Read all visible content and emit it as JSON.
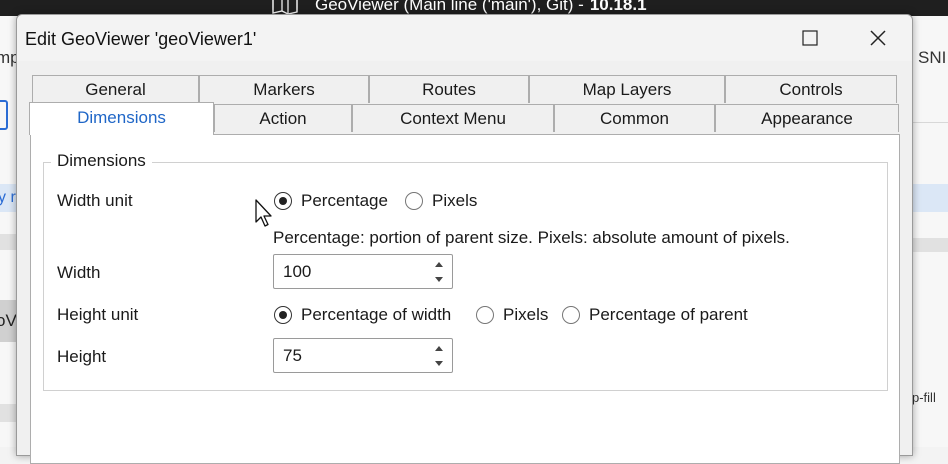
{
  "background": {
    "title": "GeoViewer (Main line ('main'), Git)  -",
    "version": "10.18.1",
    "fragments": {
      "left_top": "mp",
      "left_link": "y r",
      "left_overlay": "oV",
      "right_top": "SNI",
      "right_fill": "p-fill"
    }
  },
  "dialog": {
    "title": "Edit GeoViewer 'geoViewer1'",
    "tabs_row1": [
      "General",
      "Markers",
      "Routes",
      "Map Layers",
      "Controls"
    ],
    "tabs_row2": [
      "Dimensions",
      "Action",
      "Context Menu",
      "Common",
      "Appearance"
    ],
    "active_tab": "Dimensions",
    "group_title": "Dimensions",
    "width_unit": {
      "label": "Width unit",
      "options": [
        "Percentage",
        "Pixels"
      ],
      "selected": "Percentage",
      "hint": "Percentage: portion of parent size. Pixels: absolute amount of pixels."
    },
    "width": {
      "label": "Width",
      "value": "100"
    },
    "height_unit": {
      "label": "Height unit",
      "options": [
        "Percentage of width",
        "Pixels",
        "Percentage of parent"
      ],
      "selected": "Percentage of width"
    },
    "height": {
      "label": "Height",
      "value": "75"
    }
  }
}
